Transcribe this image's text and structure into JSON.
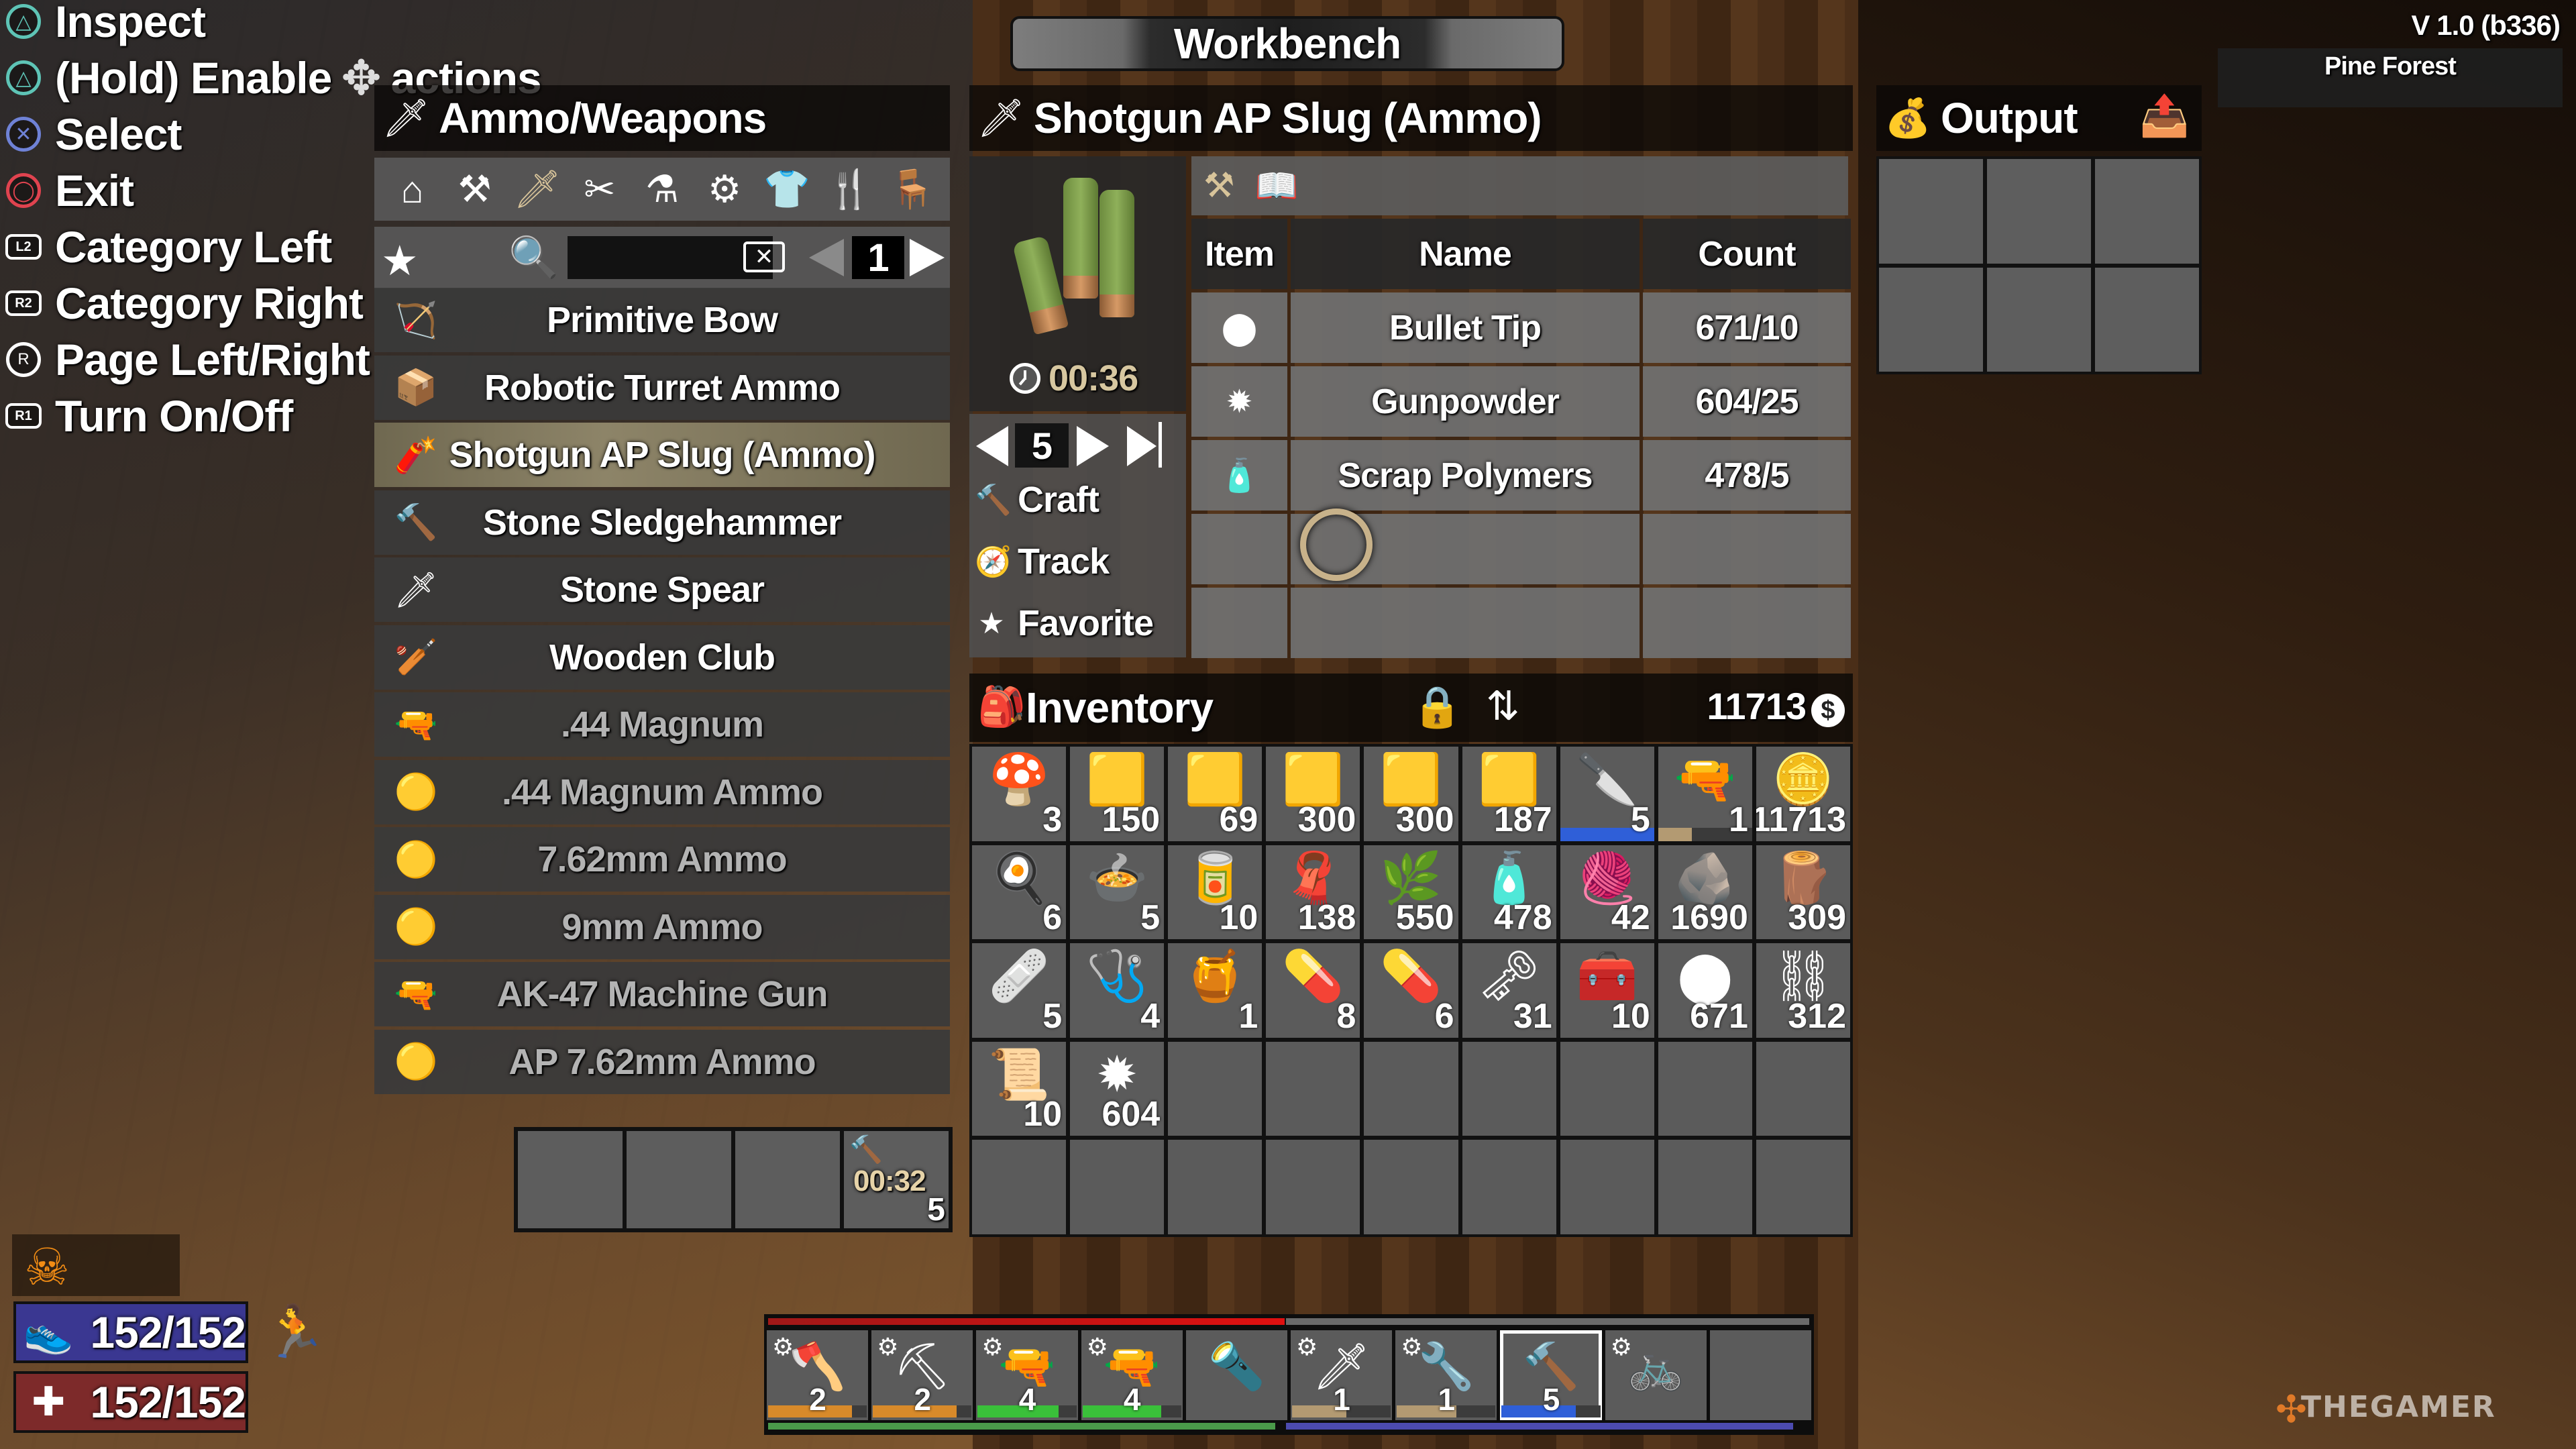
{
  "window": {
    "title": "Workbench",
    "version": "V 1.0 (b336)",
    "biome": "Pine Forest"
  },
  "help_legend": [
    {
      "button": "triangle",
      "icon": "triangle-button-icon",
      "label": "Inspect",
      "color": "#5ec4b6"
    },
    {
      "button": "triangle",
      "icon": "triangle-button-icon",
      "label": "(Hold) Enable",
      "suffix": "actions",
      "extra_icon": "dpad-icon",
      "color": "#5ec4b6"
    },
    {
      "button": "cross",
      "icon": "cross-button-icon",
      "label": "Select",
      "color": "#6f82d6"
    },
    {
      "button": "circle",
      "icon": "circle-button-icon",
      "label": "Exit",
      "color": "#e0434f"
    },
    {
      "button": "L2",
      "icon": "l2-button-icon",
      "label": "Category Left"
    },
    {
      "button": "R2",
      "icon": "r2-button-icon",
      "label": "Category Right"
    },
    {
      "button": "R",
      "icon": "right-stick-icon",
      "label": "Page Left/Right"
    },
    {
      "button": "R1",
      "icon": "r1-button-icon",
      "label": "Turn On/Off"
    }
  ],
  "recipe_panel": {
    "title": "Ammo/Weapons",
    "categories": [
      {
        "name": "basics",
        "icon": "house-icon",
        "glyph": "⌂",
        "active": false
      },
      {
        "name": "building",
        "icon": "hammer-bricks-icon",
        "glyph": "⚒",
        "active": false
      },
      {
        "name": "ammo-weapons",
        "icon": "knife-icon",
        "glyph": "🗡",
        "active": true
      },
      {
        "name": "tools",
        "icon": "tools-icon",
        "glyph": "✂",
        "active": false
      },
      {
        "name": "science",
        "icon": "microscope-icon",
        "glyph": "⚗",
        "active": false
      },
      {
        "name": "mods",
        "icon": "gears-icon",
        "glyph": "⚙",
        "active": false
      },
      {
        "name": "clothing",
        "icon": "shirt-icon",
        "glyph": "👕",
        "active": false
      },
      {
        "name": "food",
        "icon": "fork-icon",
        "glyph": "🍴",
        "active": false
      },
      {
        "name": "decor",
        "icon": "armchair-icon",
        "glyph": "🪑",
        "active": false
      }
    ],
    "search": {
      "placeholder": "",
      "value": ""
    },
    "page": "1",
    "recipes": [
      {
        "name": "Primitive Bow",
        "icon": "bow-icon",
        "glyph": "🏹",
        "locked": false,
        "selected": false
      },
      {
        "name": "Robotic Turret Ammo",
        "icon": "ammo-box-icon",
        "glyph": "📦",
        "locked": false,
        "selected": false
      },
      {
        "name": "Shotgun AP Slug (Ammo)",
        "icon": "shotgun-shell-icon",
        "glyph": "🧨",
        "locked": false,
        "selected": true
      },
      {
        "name": "Stone Sledgehammer",
        "icon": "sledgehammer-icon",
        "glyph": "🔨",
        "locked": false,
        "selected": false
      },
      {
        "name": "Stone Spear",
        "icon": "spear-icon",
        "glyph": "🗡",
        "locked": false,
        "selected": false
      },
      {
        "name": "Wooden Club",
        "icon": "club-icon",
        "glyph": "🏏",
        "locked": false,
        "selected": false
      },
      {
        "name": ".44 Magnum",
        "icon": "revolver-icon",
        "glyph": "🔫",
        "locked": true,
        "selected": false
      },
      {
        "name": ".44 Magnum Ammo",
        "icon": "bullet-icon",
        "glyph": "🟡",
        "locked": true,
        "selected": false
      },
      {
        "name": "7.62mm Ammo",
        "icon": "rifle-bullet-icon",
        "glyph": "🟡",
        "locked": true,
        "selected": false
      },
      {
        "name": "9mm Ammo",
        "icon": "bullet-icon",
        "glyph": "🟡",
        "locked": true,
        "selected": false
      },
      {
        "name": "AK-47 Machine Gun",
        "icon": "rifle-icon",
        "glyph": "🔫",
        "locked": true,
        "selected": false
      },
      {
        "name": "AP 7.62mm Ammo",
        "icon": "rifle-bullet-icon",
        "glyph": "🟡",
        "locked": true,
        "selected": false
      }
    ]
  },
  "craft_queue": {
    "slots": [
      {
        "empty": true
      },
      {
        "empty": true
      },
      {
        "empty": true
      },
      {
        "empty": false,
        "item": "Shotgun AP Slug (Ammo)",
        "time": "00:32",
        "count": "5"
      }
    ]
  },
  "recipe_detail": {
    "title": "Shotgun AP Slug (Ammo)",
    "craft_time": "00:36",
    "quantity": "5",
    "actions": [
      {
        "label": "Craft",
        "icon": "hammer-icon",
        "glyph": "🔨"
      },
      {
        "label": "Track",
        "icon": "compass-icon",
        "glyph": "🧭"
      },
      {
        "label": "Favorite",
        "icon": "star-icon",
        "glyph": "★"
      }
    ],
    "tool_icons": [
      {
        "icon": "workstation-icon",
        "glyph": "⚒"
      },
      {
        "icon": "recipe-book-icon",
        "glyph": "📖"
      }
    ],
    "ingredients_columns": [
      "Item",
      "Name",
      "Count"
    ],
    "ingredients": [
      {
        "icon": "bullet-tip-icon",
        "glyph": "⬤",
        "name": "Bullet Tip",
        "count": "671/10"
      },
      {
        "icon": "gunpowder-icon",
        "glyph": "✹",
        "name": "Gunpowder",
        "count": "604/25"
      },
      {
        "icon": "scrap-polymers-icon",
        "glyph": "🧴",
        "name": "Scrap Polymers",
        "count": "478/5"
      },
      {
        "icon": "",
        "glyph": "",
        "name": "",
        "count": ""
      },
      {
        "icon": "",
        "glyph": "",
        "name": "",
        "count": ""
      }
    ]
  },
  "output": {
    "title": "Output",
    "slot_count": 6
  },
  "inventory": {
    "title": "Inventory",
    "currency": "11713",
    "slots": [
      {
        "item": "mushrooms",
        "glyph": "🍄",
        "count": "3"
      },
      {
        "item": "7.62mm ammo",
        "glyph": "🟨",
        "count": "150"
      },
      {
        "item": "7.62mm ammo",
        "glyph": "🟨",
        "count": "69"
      },
      {
        "item": "9mm ammo",
        "glyph": "🟨",
        "count": "300"
      },
      {
        "item": "9mm ammo",
        "glyph": "🟨",
        "count": "300"
      },
      {
        "item": ".44 magnum ammo",
        "glyph": "🟨",
        "count": "187"
      },
      {
        "item": "hunting knife",
        "glyph": "🔪",
        "count": "5",
        "quality": 1.0,
        "quality_color": "#2f5fd8"
      },
      {
        "item": "shotgun",
        "glyph": "🔫",
        "count": "1",
        "quality": 0.36,
        "quality_color": "#b39a72"
      },
      {
        "item": "dukes casino token",
        "glyph": "🪙",
        "count": "11713"
      },
      {
        "item": "bacon and eggs",
        "glyph": "🍳",
        "count": "6"
      },
      {
        "item": "meat stew",
        "glyph": "🍲",
        "count": "5"
      },
      {
        "item": "tomato juice jar",
        "glyph": "🥫",
        "count": "10"
      },
      {
        "item": "cloth",
        "glyph": "🧣",
        "count": "138"
      },
      {
        "item": "plant fibers",
        "glyph": "🌿",
        "count": "550"
      },
      {
        "item": "scrap polymers",
        "glyph": "🧴",
        "count": "478"
      },
      {
        "item": "yarn and needle",
        "glyph": "🧶",
        "count": "42"
      },
      {
        "item": "stone",
        "glyph": "🪨",
        "count": "1690"
      },
      {
        "item": "wood",
        "glyph": "🪵",
        "count": "309"
      },
      {
        "item": "bandage",
        "glyph": "🩹",
        "count": "5"
      },
      {
        "item": "first aid kit",
        "glyph": "🩺",
        "count": "4"
      },
      {
        "item": "honey jar",
        "glyph": "🍯",
        "count": "1"
      },
      {
        "item": "painkillers",
        "glyph": "💊",
        "count": "8"
      },
      {
        "item": "antibiotics",
        "glyph": "💊",
        "count": "6"
      },
      {
        "item": "lockpicks",
        "glyph": "🗝",
        "count": "31"
      },
      {
        "item": "repair kit",
        "glyph": "🧰",
        "count": "10"
      },
      {
        "item": "bullet tips",
        "glyph": "⬤",
        "count": "671"
      },
      {
        "item": "scrap iron",
        "glyph": "⛓",
        "count": "312"
      },
      {
        "item": "paper",
        "glyph": "📜",
        "count": "10"
      },
      {
        "item": "gunpowder",
        "glyph": "✹",
        "count": "604"
      }
    ],
    "total_slots": 45
  },
  "player_stats": {
    "status_icon": "grim-reaper-icon",
    "stamina": "152/152",
    "health": "152/152"
  },
  "toolbelt": {
    "selected_index": 7,
    "slots": [
      {
        "item": "fireaxe",
        "glyph": "🪓",
        "count": "2",
        "mods": true,
        "quality": 0.85,
        "quality_color": "#d88a2a"
      },
      {
        "item": "pickaxe",
        "glyph": "⛏",
        "count": "2",
        "mods": true,
        "quality": 0.85,
        "quality_color": "#d88a2a"
      },
      {
        "item": "ak-47",
        "glyph": "🔫",
        "count": "4",
        "mods": true,
        "quality": 0.82,
        "quality_color": "#3ac03a"
      },
      {
        "item": "pistol",
        "glyph": "🔫",
        "count": "4",
        "mods": true,
        "quality": 0.8,
        "quality_color": "#3ac03a"
      },
      {
        "item": "flashlight",
        "glyph": "🔦",
        "count": "",
        "mods": false
      },
      {
        "item": "spear",
        "glyph": "🗡",
        "count": "1",
        "mods": true,
        "quality": 0.55,
        "quality_color": "#b39a72"
      },
      {
        "item": "wrench",
        "glyph": "🔧",
        "count": "1",
        "mods": true,
        "quality": 0.6,
        "quality_color": "#b39a72"
      },
      {
        "item": "claw hammer",
        "glyph": "🔨",
        "count": "5",
        "mods": false,
        "quality": 0.75,
        "quality_color": "#2f5fd8"
      },
      {
        "item": "bicycle",
        "glyph": "🚲",
        "count": "",
        "mods": true
      },
      {
        "item": "",
        "glyph": "",
        "count": "",
        "mods": false
      }
    ]
  },
  "watermark": "THEGAMER"
}
